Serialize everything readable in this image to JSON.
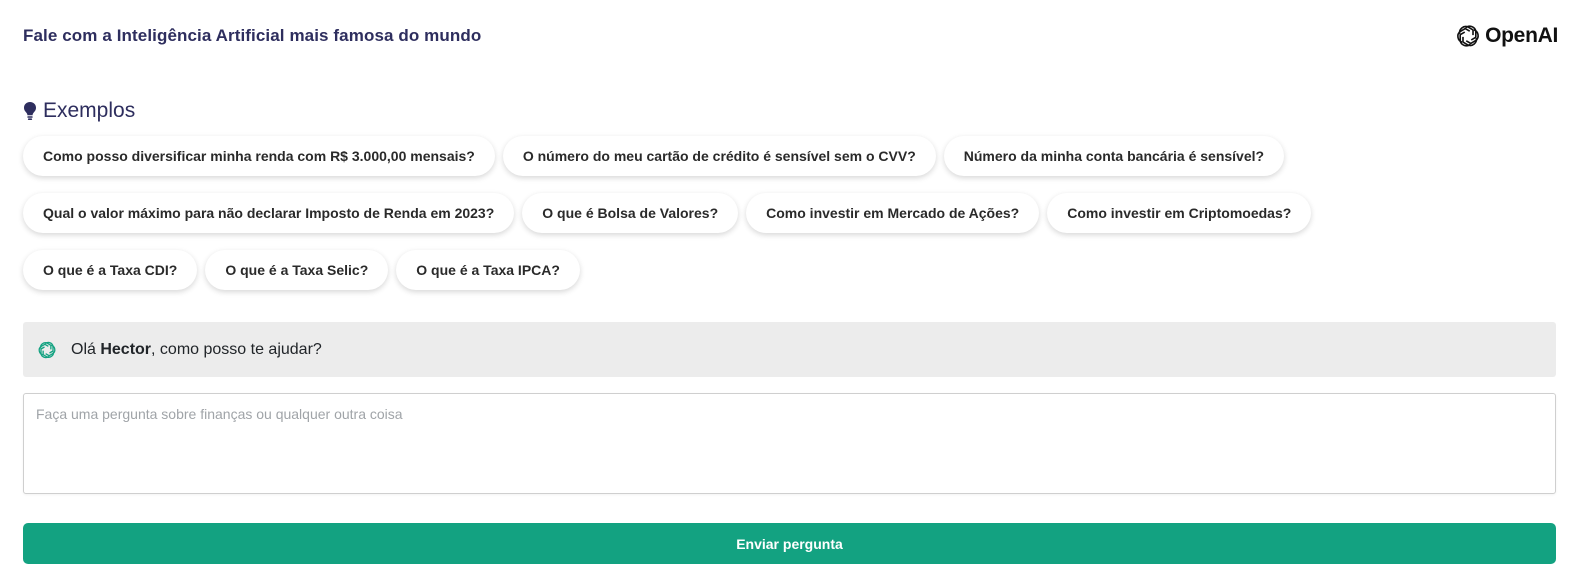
{
  "header": {
    "title": "Fale com a Inteligência Artificial mais famosa do mundo",
    "brand_name": "OpenAI",
    "brand_icon": "openai-logo-icon"
  },
  "examples": {
    "icon": "lightbulb-icon",
    "title": "Exemplos",
    "rows": [
      [
        "Como posso diversificar minha renda com R$ 3.000,00 mensais?",
        "O número do meu cartão de crédito é sensível sem o CVV?",
        "Número da minha conta bancária é sensível?"
      ],
      [
        "Qual o valor máximo para não declarar Imposto de Renda em 2023?",
        "O que é Bolsa de Valores?",
        "Como investir em Mercado de Ações?",
        "Como investir em Criptomoedas?"
      ],
      [
        "O que é a Taxa CDI?",
        "O que é a Taxa Selic?",
        "O que é a Taxa IPCA?"
      ]
    ]
  },
  "greeting": {
    "icon": "chatgpt-icon",
    "prefix": "Olá ",
    "user_name": "Hector",
    "suffix": ", como posso te ajudar?"
  },
  "question": {
    "value": "",
    "placeholder": "Faça uma pergunta sobre finanças ou qualquer outra coisa"
  },
  "submit": {
    "label": "Enviar pergunta"
  },
  "colors": {
    "accent": "#13a281",
    "heading": "#2e2e5e",
    "greeting_bg": "#ececec"
  }
}
